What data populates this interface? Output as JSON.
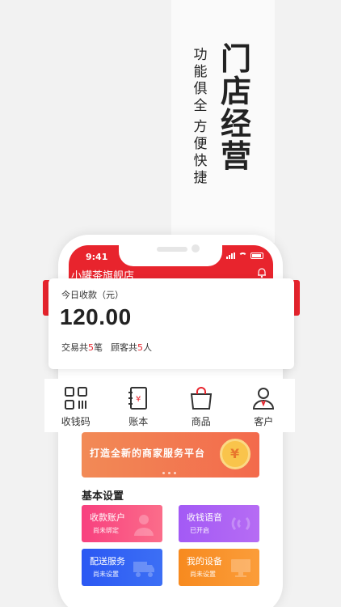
{
  "promo": {
    "headline": "门店经营",
    "subline_1": "功能俱全",
    "subline_2": "方便快捷"
  },
  "status_bar": {
    "time": "9:41",
    "icons": [
      "signal-icon",
      "wifi-icon",
      "battery-icon"
    ]
  },
  "header": {
    "store_name": "小罐茶旗舰店",
    "bell_icon": "bell-icon"
  },
  "summary_card": {
    "label": "今日收款（元）",
    "amount": "120.00",
    "transactions_prefix": "交易共",
    "transactions_count": "5",
    "transactions_unit": "笔",
    "customers_prefix": "顾客共",
    "customers_count": "5",
    "customers_unit": "人"
  },
  "quick_actions": [
    {
      "label": "收钱码",
      "icon": "qr-code-icon"
    },
    {
      "label": "账本",
      "icon": "ledger-icon"
    },
    {
      "label": "商品",
      "icon": "shopping-bag-icon"
    },
    {
      "label": "客户",
      "icon": "customer-icon"
    }
  ],
  "banner": {
    "text": "打造全新的商家服务平台",
    "icon": "coin-icon",
    "coin_symbol": "¥"
  },
  "settings": {
    "title": "基本设置",
    "tiles": [
      {
        "title": "收款账户",
        "status": "尚未绑定",
        "icon": "user-icon",
        "color": "#f8407f"
      },
      {
        "title": "收钱语音",
        "status": "已开启",
        "icon": "sound-icon",
        "color": "#a35af5"
      },
      {
        "title": "配送服务",
        "status": "尚未设置",
        "icon": "truck-icon",
        "color": "#2b58f3"
      },
      {
        "title": "我的设备",
        "status": "尚未设置",
        "icon": "monitor-icon",
        "color": "#f78a1f"
      }
    ]
  },
  "colors": {
    "brand_red": "#e8242d",
    "highlight_count": "#e8242d"
  }
}
